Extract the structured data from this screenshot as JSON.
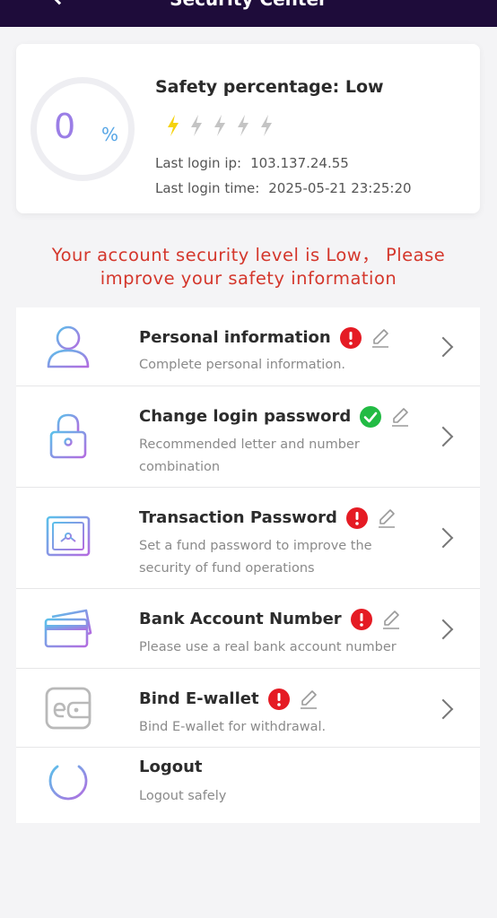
{
  "header": {
    "title": "Security Center"
  },
  "safety": {
    "percent_value": "0",
    "percent_unit": "%",
    "title": "Safety percentage: Low",
    "bolts_active": 1,
    "bolts_total": 5,
    "last_login_ip_label": "Last login ip:",
    "last_login_ip": "103.137.24.55",
    "last_login_time_label": "Last login time:",
    "last_login_time": "2025-05-21 23:25:20"
  },
  "warning": {
    "line1": "Your account security level is Low， Please",
    "line2": "improve your safety information"
  },
  "items": [
    {
      "label": "Personal information",
      "status": "error",
      "desc1": "Complete personal information.",
      "desc2": ""
    },
    {
      "label": "Change login password",
      "status": "ok",
      "desc1": "Recommended letter and number",
      "desc2": "combination"
    },
    {
      "label": "Transaction Password",
      "status": "error",
      "desc1": "Set a fund password to improve the",
      "desc2": "security of fund operations"
    },
    {
      "label": "Bank Account Number",
      "status": "error",
      "desc1": "Please use a real bank account number",
      "desc2": ""
    },
    {
      "label": "Bind E-wallet",
      "status": "error",
      "desc1": "Bind E-wallet for withdrawal.",
      "desc2": ""
    },
    {
      "label": "Logout",
      "status": "none",
      "desc1": "Logout safely",
      "desc2": ""
    }
  ],
  "icons": {
    "bolt_active": "lightning-bolt-icon",
    "bolt_inactive": "lightning-bolt-icon",
    "error": "exclamation-icon",
    "ok": "checkmark-icon",
    "edit": "pencil-icon",
    "chevron": "chevron-right-icon"
  },
  "colors": {
    "header_bg": "#1e0c3a",
    "warning": "#d4372c",
    "error": "#e51b24",
    "ok": "#22bb44",
    "bolt_active": "#f5d20c",
    "bolt_inactive": "#c4c4c4"
  }
}
